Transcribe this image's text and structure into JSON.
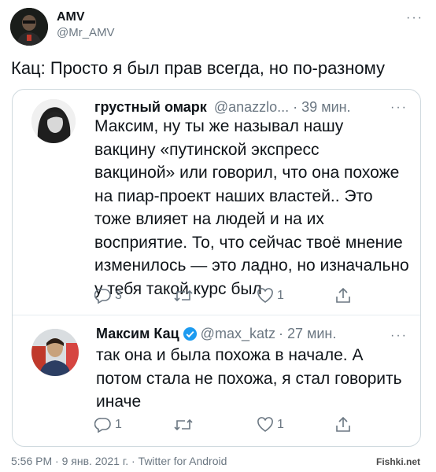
{
  "author": {
    "name": "AMV",
    "handle": "@Mr_AMV"
  },
  "tweet_text": "Кац: Просто я был прав всегда, но по-разному",
  "quoted_tweet": {
    "name": "грустный омарк",
    "handle": "@anazzlo...",
    "time": "· 39 мин.",
    "lines": [
      "Максим, ну ты же называл нашу",
      "вакцину «путинской экспресс",
      "вакциной» или говорил, что она похоже",
      "на пиар-проект наших властей.. Это",
      "тоже влияет на людей и на их",
      "восприятие. То, что сейчас твоё мнение",
      "изменилось — это ладно, но изначально",
      "у тебя такой курс был"
    ],
    "reply_count": "3",
    "like_count": "1"
  },
  "reply_tweet": {
    "name": "Максим Кац",
    "handle": "@max_katz",
    "time": "· 27 мин.",
    "lines": [
      "так она и была похожа в начале. А",
      "потом стала не похожа, я стал говорить",
      "иначе"
    ],
    "reply_count": "1",
    "like_count": "1"
  },
  "footer": {
    "meta": "5:56 PM · 9 янв. 2021 г. · Twitter for Android",
    "watermark": "Fishki.net"
  },
  "colors": {
    "text": "#0f1419",
    "muted": "#6b7782",
    "border": "#cfd9de",
    "verified": "#1d9bf0"
  }
}
